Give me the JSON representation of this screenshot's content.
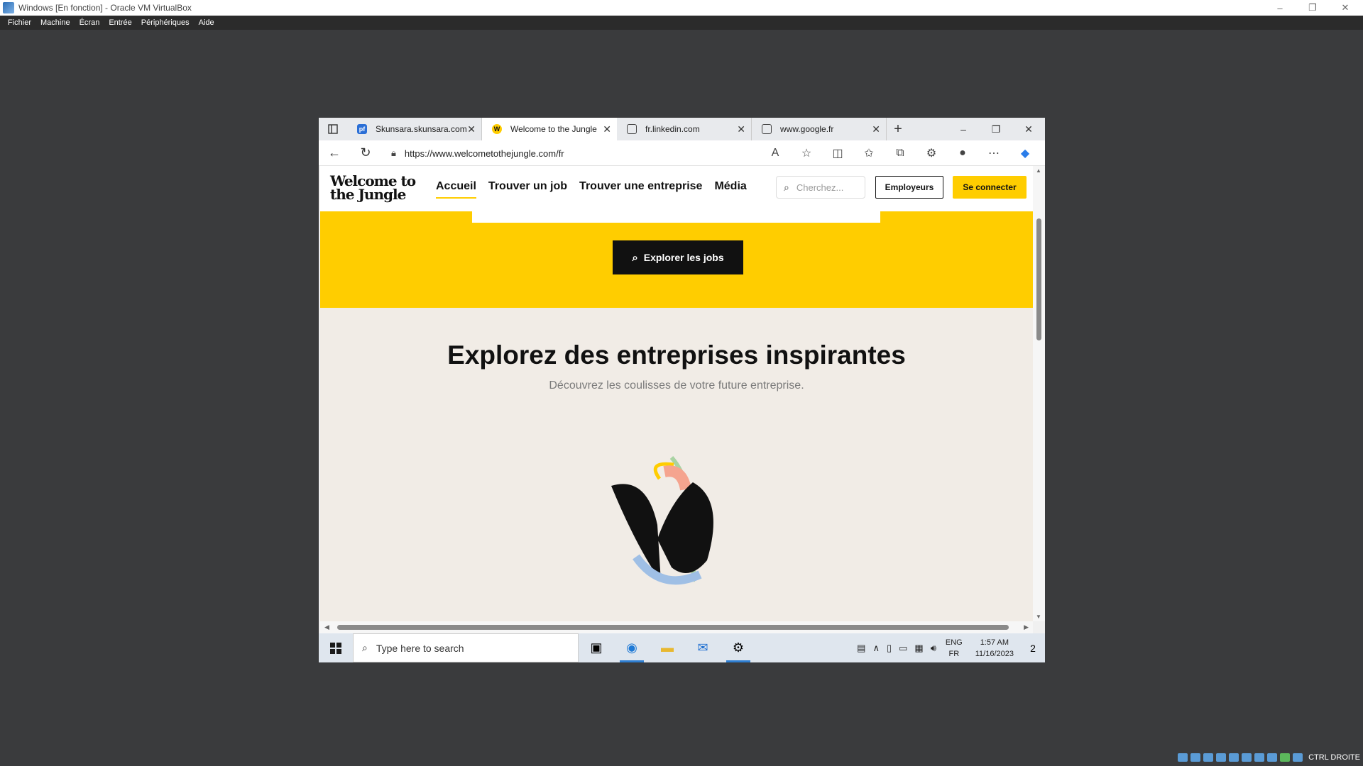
{
  "host": {
    "title": "Windows [En fonction] - Oracle VM VirtualBox",
    "menu": [
      "Fichier",
      "Machine",
      "Écran",
      "Entrée",
      "Périphériques",
      "Aide"
    ],
    "window_controls": [
      "–",
      "❐",
      "✕"
    ],
    "host_key": "CTRL DROITE"
  },
  "browser": {
    "tabs": [
      {
        "label": "Skunsara.skunsara.com",
        "icon": "pf-icon",
        "favicon_text": "pf",
        "favicon_color": "#2b6fd6",
        "active": false
      },
      {
        "label": "Welcome to the Jungle",
        "icon": "wttj-icon",
        "favicon_text": "W",
        "favicon_color": "#ffcd00",
        "active": true
      },
      {
        "label": "fr.linkedin.com",
        "icon": "page-icon",
        "favicon_text": "▢",
        "favicon_color": "#ffffff",
        "active": false
      },
      {
        "label": "www.google.fr",
        "icon": "page-icon",
        "favicon_text": "▢",
        "favicon_color": "#ffffff",
        "active": false
      }
    ],
    "tab_close": "✕",
    "new_tab": "+",
    "url": "https://www.welcometothejungle.com/fr",
    "window_controls": [
      "–",
      "❐",
      "✕"
    ]
  },
  "site": {
    "logo": "Welcome to the Jungle",
    "nav": [
      "Accueil",
      "Trouver un job",
      "Trouver une entreprise",
      "Média"
    ],
    "search_placeholder": "Cherchez...",
    "employers_button": "Employeurs",
    "login_button": "Se connecter",
    "explore_button": "Explorer les jobs",
    "section_title": "Explorez des entreprises inspirantes",
    "section_subtitle": "Découvrez les coulisses de votre future entreprise.",
    "brand_color": "#ffcd00"
  },
  "taskbar": {
    "search_placeholder": "Type here to search",
    "lang_top": "ENG",
    "lang_bottom": "FR",
    "time": "1:57 AM",
    "date": "11/16/2023",
    "notifications": "2"
  }
}
